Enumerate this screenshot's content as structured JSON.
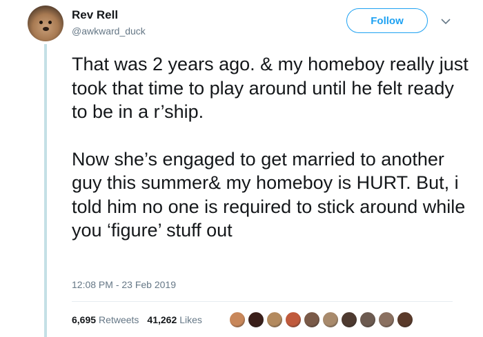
{
  "author": {
    "display_name": "Rev Rell",
    "handle": "@awkward_duck"
  },
  "follow_button": {
    "label": "Follow"
  },
  "tweet": {
    "paragraphs": [
      "That was 2 years ago. & my homeboy really just took that time to play around until he felt ready to be in a r’ship.",
      "Now she’s engaged to get married to another guy this summer& my homeboy is HURT. But, i told him no one is required to stick around while you ‘figure’ stuff out"
    ],
    "timestamp": "12:08 PM - 23 Feb 2019"
  },
  "stats": {
    "retweets_count": "6,695",
    "retweets_label": "Retweets",
    "likes_count": "41,262",
    "likes_label": "Likes"
  },
  "liker_avatar_colors": [
    "#c8875a",
    "#3a1f1a",
    "#b38a5e",
    "#c05a3c",
    "#7a5a48",
    "#a88a6c",
    "#4e3a30",
    "#6c5a50",
    "#8a7060",
    "#5a3a2a"
  ]
}
